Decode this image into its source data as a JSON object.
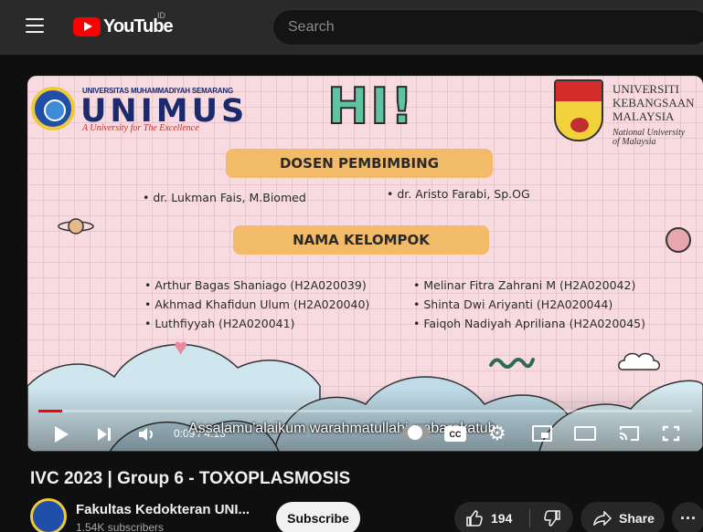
{
  "header": {
    "logo_text": "YouTube",
    "region": "ID",
    "search_placeholder": "Search"
  },
  "slide": {
    "university_left_small": "UNIVERSITAS MUHAMMADIYAH SEMARANG",
    "university_left_big": "UNIMUS",
    "university_left_tagline": "A University for The Excellence",
    "greeting": "HI!",
    "university_right_line1": "UNIVERSITI",
    "university_right_line2": "KEBANGSAAN",
    "university_right_line3": "MALAYSIA",
    "university_right_sub1": "National University",
    "university_right_sub2": "of Malaysia",
    "supervisor_heading": "DOSEN PEMBIMBING",
    "supervisors": [
      "• dr. Lukman Fais, M.Biomed",
      "• dr. Aristo Farabi, Sp.OG"
    ],
    "members_heading": "NAMA KELOMPOK",
    "members_left": [
      "• Arthur Bagas Shaniago (H2A020039)",
      "• Akhmad Khafidun Ulum (H2A020040)",
      "• Luthfiyyah (H2A020041)"
    ],
    "members_right": [
      "• Melinar Fitra Zahrani M (H2A020042)",
      "• Shinta Dwi Ariyanti (H2A020044)",
      "• Faiqoh Nadiyah Apriliana (H2A020045)"
    ]
  },
  "player": {
    "progress": 0.037,
    "time": "0:09 / 4:13",
    "caption": "Assalamu'alaikum warahmatullahi wabarakatuh",
    "cc_label": "CC",
    "accent": "#ff0000"
  },
  "video": {
    "title": "IVC 2023 | Group 6 - TOXOPLASMOSIS",
    "channel": "Fakultas Kedokteran UNI...",
    "subscribers": "1.54K subscribers",
    "subscribe_label": "Subscribe",
    "likes": "194",
    "share_label": "Share",
    "more_label": "···"
  }
}
